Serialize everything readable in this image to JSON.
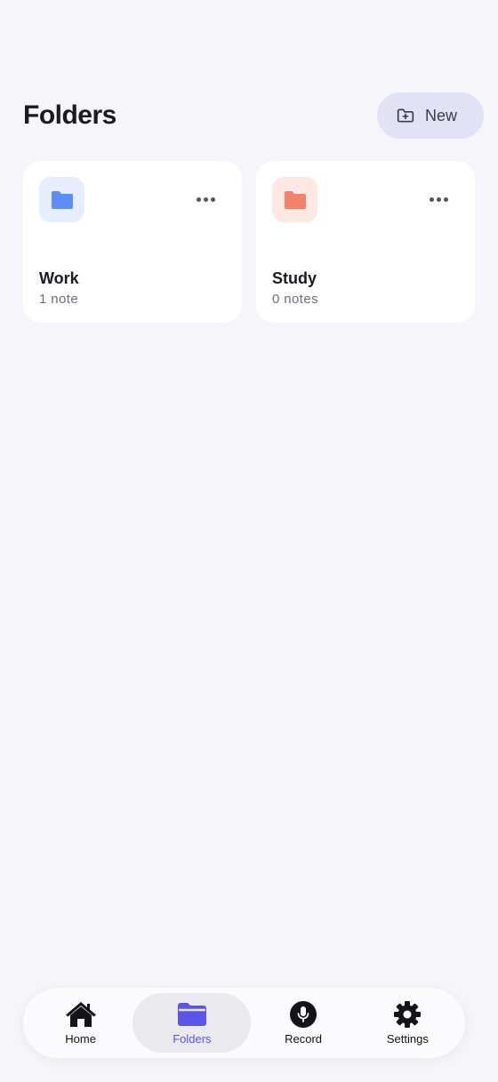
{
  "header": {
    "title": "Folders",
    "new_button_label": "New",
    "new_button_icon": "folder-plus-icon"
  },
  "folders": [
    {
      "name": "Work",
      "count": "1 note",
      "icon": "folder-icon",
      "icon_color": "#5b8ef8",
      "icon_bg": "#e6eefd"
    },
    {
      "name": "Study",
      "count": "0 notes",
      "icon": "folder-icon",
      "icon_color": "#f2826a",
      "icon_bg": "#fde9e4"
    }
  ],
  "tab_bar": {
    "active": "Folders",
    "accent_color": "#5a55e8",
    "tabs": [
      {
        "label": "Home",
        "icon": "home-icon"
      },
      {
        "label": "Folders",
        "icon": "folder-icon"
      },
      {
        "label": "Record",
        "icon": "microphone-icon"
      },
      {
        "label": "Settings",
        "icon": "gear-icon"
      }
    ]
  }
}
